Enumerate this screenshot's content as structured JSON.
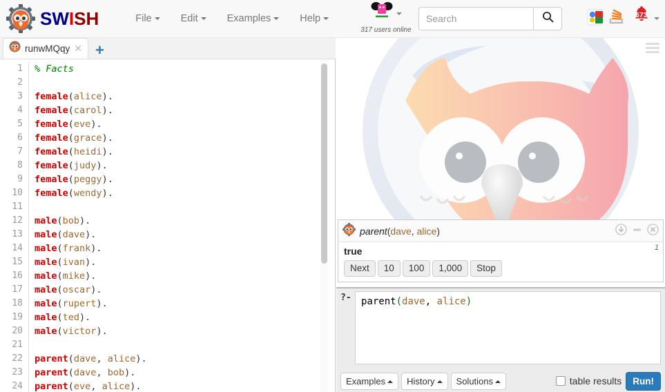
{
  "app": {
    "brand_part1": "SW",
    "brand_part2": "I",
    "brand_part3": "SH",
    "logo_icon": "swish-owl-gear-logo"
  },
  "navbar": {
    "menus": [
      {
        "label": "File",
        "name": "nav-item-file"
      },
      {
        "label": "Edit",
        "name": "nav-item-edit"
      },
      {
        "label": "Examples",
        "name": "nav-item-examples"
      },
      {
        "label": "Help",
        "name": "nav-item-help"
      }
    ],
    "user": {
      "avatar_icon": "pink-user-avatar",
      "online_text": "317 users online"
    },
    "search": {
      "placeholder": "Search",
      "value": "",
      "button_icon": "search-icon"
    },
    "right_icons": [
      {
        "name": "google-icon",
        "label": "Google"
      },
      {
        "name": "stackoverflow-icon",
        "label": "Stack Overflow"
      }
    ],
    "notifications": {
      "icon": "bell-icon",
      "count": "673"
    }
  },
  "tabbar": {
    "tabs": [
      {
        "label": "runwMQqy",
        "icon": "owl-tab-icon",
        "close_glyph": "✕"
      }
    ],
    "add_glyph": "+"
  },
  "editor": {
    "lines": [
      {
        "n": "1",
        "segments": [
          {
            "t": "% Facts",
            "c": "tok-comment"
          }
        ]
      },
      {
        "n": "2",
        "segments": []
      },
      {
        "n": "3",
        "segments": [
          {
            "t": "female",
            "c": "tok-pred"
          },
          {
            "t": "(",
            "c": "tok-punct"
          },
          {
            "t": "alice",
            "c": "tok-atom"
          },
          {
            "t": ").",
            "c": "tok-punct"
          }
        ]
      },
      {
        "n": "4",
        "segments": [
          {
            "t": "female",
            "c": "tok-pred"
          },
          {
            "t": "(",
            "c": "tok-punct"
          },
          {
            "t": "carol",
            "c": "tok-atom"
          },
          {
            "t": ").",
            "c": "tok-punct"
          }
        ]
      },
      {
        "n": "5",
        "segments": [
          {
            "t": "female",
            "c": "tok-pred"
          },
          {
            "t": "(",
            "c": "tok-punct"
          },
          {
            "t": "eve",
            "c": "tok-atom"
          },
          {
            "t": ").",
            "c": "tok-punct"
          }
        ]
      },
      {
        "n": "6",
        "segments": [
          {
            "t": "female",
            "c": "tok-pred"
          },
          {
            "t": "(",
            "c": "tok-punct"
          },
          {
            "t": "grace",
            "c": "tok-atom"
          },
          {
            "t": ").",
            "c": "tok-punct"
          }
        ]
      },
      {
        "n": "7",
        "segments": [
          {
            "t": "female",
            "c": "tok-pred"
          },
          {
            "t": "(",
            "c": "tok-punct"
          },
          {
            "t": "heidi",
            "c": "tok-atom"
          },
          {
            "t": ").",
            "c": "tok-punct"
          }
        ]
      },
      {
        "n": "8",
        "segments": [
          {
            "t": "female",
            "c": "tok-pred"
          },
          {
            "t": "(",
            "c": "tok-punct"
          },
          {
            "t": "judy",
            "c": "tok-atom"
          },
          {
            "t": ").",
            "c": "tok-punct"
          }
        ]
      },
      {
        "n": "9",
        "segments": [
          {
            "t": "female",
            "c": "tok-pred"
          },
          {
            "t": "(",
            "c": "tok-punct"
          },
          {
            "t": "peggy",
            "c": "tok-atom"
          },
          {
            "t": ").",
            "c": "tok-punct"
          }
        ]
      },
      {
        "n": "10",
        "segments": [
          {
            "t": "female",
            "c": "tok-pred"
          },
          {
            "t": "(",
            "c": "tok-punct"
          },
          {
            "t": "wendy",
            "c": "tok-atom"
          },
          {
            "t": ").",
            "c": "tok-punct"
          }
        ]
      },
      {
        "n": "11",
        "segments": []
      },
      {
        "n": "12",
        "segments": [
          {
            "t": "male",
            "c": "tok-pred"
          },
          {
            "t": "(",
            "c": "tok-punct"
          },
          {
            "t": "bob",
            "c": "tok-atom"
          },
          {
            "t": ").",
            "c": "tok-punct"
          }
        ]
      },
      {
        "n": "13",
        "segments": [
          {
            "t": "male",
            "c": "tok-pred"
          },
          {
            "t": "(",
            "c": "tok-punct"
          },
          {
            "t": "dave",
            "c": "tok-atom"
          },
          {
            "t": ").",
            "c": "tok-punct"
          }
        ]
      },
      {
        "n": "14",
        "segments": [
          {
            "t": "male",
            "c": "tok-pred"
          },
          {
            "t": "(",
            "c": "tok-punct"
          },
          {
            "t": "frank",
            "c": "tok-atom"
          },
          {
            "t": ").",
            "c": "tok-punct"
          }
        ]
      },
      {
        "n": "15",
        "segments": [
          {
            "t": "male",
            "c": "tok-pred"
          },
          {
            "t": "(",
            "c": "tok-punct"
          },
          {
            "t": "ivan",
            "c": "tok-atom"
          },
          {
            "t": ").",
            "c": "tok-punct"
          }
        ]
      },
      {
        "n": "16",
        "segments": [
          {
            "t": "male",
            "c": "tok-pred"
          },
          {
            "t": "(",
            "c": "tok-punct"
          },
          {
            "t": "mike",
            "c": "tok-atom"
          },
          {
            "t": ").",
            "c": "tok-punct"
          }
        ]
      },
      {
        "n": "17",
        "segments": [
          {
            "t": "male",
            "c": "tok-pred"
          },
          {
            "t": "(",
            "c": "tok-punct"
          },
          {
            "t": "oscar",
            "c": "tok-atom"
          },
          {
            "t": ").",
            "c": "tok-punct"
          }
        ]
      },
      {
        "n": "18",
        "segments": [
          {
            "t": "male",
            "c": "tok-pred"
          },
          {
            "t": "(",
            "c": "tok-punct"
          },
          {
            "t": "rupert",
            "c": "tok-atom"
          },
          {
            "t": ").",
            "c": "tok-punct"
          }
        ]
      },
      {
        "n": "19",
        "segments": [
          {
            "t": "male",
            "c": "tok-pred"
          },
          {
            "t": "(",
            "c": "tok-punct"
          },
          {
            "t": "ted",
            "c": "tok-atom"
          },
          {
            "t": ").",
            "c": "tok-punct"
          }
        ]
      },
      {
        "n": "20",
        "segments": [
          {
            "t": "male",
            "c": "tok-pred"
          },
          {
            "t": "(",
            "c": "tok-punct"
          },
          {
            "t": "victor",
            "c": "tok-atom"
          },
          {
            "t": ").",
            "c": "tok-punct"
          }
        ]
      },
      {
        "n": "21",
        "segments": []
      },
      {
        "n": "22",
        "segments": [
          {
            "t": "parent",
            "c": "tok-pred"
          },
          {
            "t": "(",
            "c": "tok-punct"
          },
          {
            "t": "dave",
            "c": "tok-atom"
          },
          {
            "t": ", ",
            "c": "tok-punct"
          },
          {
            "t": "alice",
            "c": "tok-atom"
          },
          {
            "t": ").",
            "c": "tok-punct"
          }
        ]
      },
      {
        "n": "23",
        "segments": [
          {
            "t": "parent",
            "c": "tok-pred"
          },
          {
            "t": "(",
            "c": "tok-punct"
          },
          {
            "t": "dave",
            "c": "tok-atom"
          },
          {
            "t": ", ",
            "c": "tok-punct"
          },
          {
            "t": "bob",
            "c": "tok-atom"
          },
          {
            "t": ").",
            "c": "tok-punct"
          }
        ]
      },
      {
        "n": "24",
        "segments": [
          {
            "t": "parent",
            "c": "tok-pred"
          },
          {
            "t": "(",
            "c": "tok-punct"
          },
          {
            "t": "eve",
            "c": "tok-atom"
          },
          {
            "t": ", ",
            "c": "tok-punct"
          },
          {
            "t": "alice",
            "c": "tok-atom"
          },
          {
            "t": ").",
            "c": "tok-punct"
          }
        ]
      }
    ]
  },
  "right_pane": {
    "watermark_icon": "owl-watermark",
    "menu_icon": "hamburger-menu-icon"
  },
  "answer_panel": {
    "icon": "owl-gear-icon",
    "query_name": "parent",
    "query_open": "(",
    "query_arg1": "dave",
    "query_sep": ", ",
    "query_arg2": "alice",
    "query_close": ")",
    "head_icons": [
      {
        "name": "download-icon"
      },
      {
        "name": "minimize-icon"
      },
      {
        "name": "close-icon"
      }
    ],
    "result": "true",
    "count": "1",
    "buttons": [
      {
        "label": "Next",
        "name": "next-button"
      },
      {
        "label": "10",
        "name": "next-10-button"
      },
      {
        "label": "100",
        "name": "next-100-button"
      },
      {
        "label": "1,000",
        "name": "next-1000-button"
      },
      {
        "label": "Stop",
        "name": "stop-button"
      }
    ]
  },
  "query_editor": {
    "prompt": "?-",
    "query_name": "parent",
    "query_open": "(",
    "query_arg1": "dave",
    "query_sep": ", ",
    "query_arg2": "alice",
    "query_close": ")",
    "toolbar_buttons": [
      {
        "label": "Examples",
        "name": "examples-dropup-button"
      },
      {
        "label": "History",
        "name": "history-dropup-button"
      },
      {
        "label": "Solutions",
        "name": "solutions-dropup-button"
      }
    ],
    "table_results_label": "table results",
    "table_results_checked": false,
    "run_label": "Run!"
  },
  "colors": {
    "brand_blue": "#000080",
    "brand_red": "#8b0000",
    "accent_blue": "#2b7bba",
    "comment_green": "#008000",
    "predicate_red": "#d00000",
    "atom_brown": "#9b6a2f",
    "notification_red": "#e02020"
  }
}
